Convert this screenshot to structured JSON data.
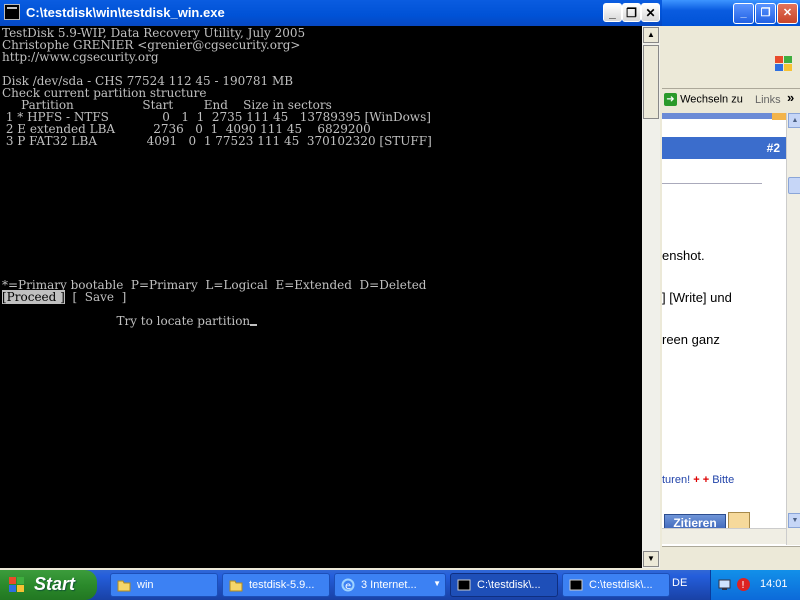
{
  "console": {
    "title": "C:\\testdisk\\win\\testdisk_win.exe",
    "lines": [
      "TestDisk 5.9-WIP, Data Recovery Utility, July 2005",
      "Christophe GRENIER <grenier@cgsecurity.org>",
      "http://www.cgsecurity.org",
      "",
      "Disk /dev/sda - CHS 77524 112 45 - 190781 MB",
      "Check current partition structure",
      "     Partition                  Start        End    Size in sectors",
      " 1 * HPFS - NTFS              0   1  1  2735 111 45   13789395 [WinDows]",
      " 2 E extended LBA          2736   0  1  4090 111 45    6829200",
      " 3 P FAT32 LBA             4091   0  1 77523 111 45  370102320 [STUFF]",
      "",
      "",
      "",
      "",
      "",
      "",
      "",
      "",
      "",
      "",
      "",
      "*=Primary bootable  P=Primary  L=Logical  E=Extended  D=Deleted"
    ],
    "menu": {
      "proceed": "[Proceed ]",
      "save": "[  Save  ]"
    },
    "status": "Try to locate partition"
  },
  "browser": {
    "toolbar_go": "Wechseln zu",
    "toolbar_links": "Links",
    "post_number": "#2",
    "text_lines": [
      "enshot.",
      "] [Write] und",
      "reen ganz"
    ],
    "tools_text": "turen!",
    "tools_bitte": "Bitte",
    "quote_button": "Zitieren"
  },
  "taskbar": {
    "start": "Start",
    "buttons": [
      {
        "label": "win",
        "icon": "folder-icon"
      },
      {
        "label": "testdisk-5.9...",
        "icon": "folder-icon"
      },
      {
        "label": "3 Internet...",
        "icon": "ie-icon"
      },
      {
        "label": "C:\\testdisk\\...",
        "icon": "console-icon"
      },
      {
        "label": "C:\\testdisk\\...",
        "icon": "console-icon"
      }
    ],
    "language": "DE",
    "clock": "14:01"
  },
  "colors": {
    "xp_blue": "#0052d6",
    "terminal_fg": "#c0c0c0",
    "terminal_bg": "#000000",
    "start_green": "#2b8a2b"
  }
}
